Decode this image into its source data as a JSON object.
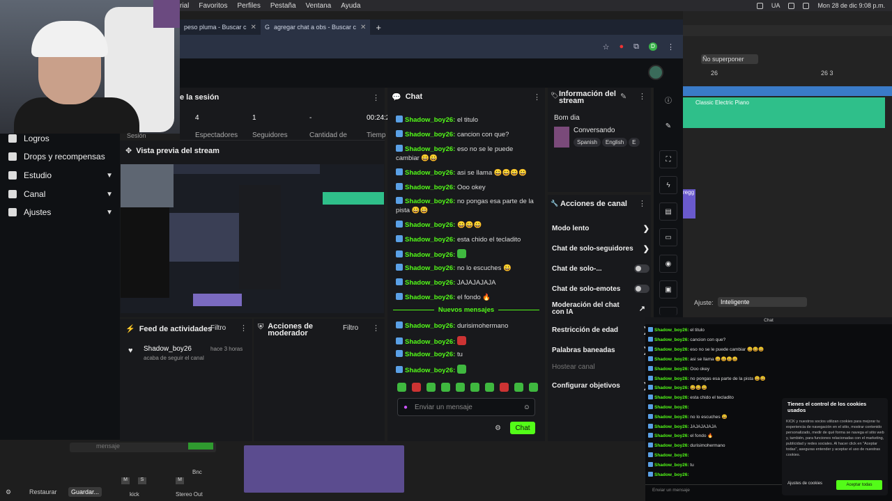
{
  "menubar": {
    "items": [
      "rial",
      "Favoritos",
      "Perfiles",
      "Pestaña",
      "Ventana",
      "Ayuda"
    ],
    "lang": "UA",
    "date": "Mon 28 de dic 9:08 p.m."
  },
  "browser": {
    "tabs": [
      "peso pluma - Buscar c",
      "agregar chat a obs - Buscar c"
    ],
    "profile_letter": "D"
  },
  "sidebar": {
    "items": [
      {
        "label": "Logros",
        "chev": false
      },
      {
        "label": "Drops y recompensas",
        "chev": false
      },
      {
        "label": "Estudio",
        "chev": true
      },
      {
        "label": "Canal",
        "chev": true
      },
      {
        "label": "Ajustes",
        "chev": true
      }
    ],
    "partial": "Sesión"
  },
  "session": {
    "title": "e la sesión",
    "stats": [
      {
        "v": "4",
        "l": "Espectadores"
      },
      {
        "v": "1",
        "l": "Seguidores"
      },
      {
        "v": "-",
        "l": "Cantidad de"
      },
      {
        "v": "00:24:2",
        "l": "Tiemp"
      }
    ]
  },
  "preview": {
    "title": "Vista previa del stream"
  },
  "feed": {
    "title": "Feed de actividades",
    "filter": "Filtro",
    "user": "Shadow_boy26",
    "time": "hace 3 horas",
    "desc": "acaba de seguir el canal"
  },
  "modactions": {
    "title": "Acciones de moderador",
    "filter": "Filtro"
  },
  "chat": {
    "title": "Chat",
    "messages": [
      {
        "u": "Shadow_boy26:",
        "t": "el titulo"
      },
      {
        "u": "Shadow_boy26:",
        "t": "cancion con que?"
      },
      {
        "u": "Shadow_boy26:",
        "t": "eso no se le puede cambiar 😀😀"
      },
      {
        "u": "Shadow_boy26:",
        "t": "asi se llama 😀😀😀😀"
      },
      {
        "u": "Shadow_boy26:",
        "t": "Ooo okey"
      },
      {
        "u": "Shadow_boy26:",
        "t": "no pongas esa parte de la pista 😀😀"
      },
      {
        "u": "Shadow_boy26:",
        "t": "😀😀😀"
      },
      {
        "u": "Shadow_boy26:",
        "t": "esta chido el tecladito"
      },
      {
        "u": "Shadow_boy26:",
        "t": ""
      },
      {
        "u": "Shadow_boy26:",
        "t": "no lo escuches 😀"
      },
      {
        "u": "Shadow_boy26:",
        "t": "JAJAJAJAJA"
      },
      {
        "u": "Shadow_boy26:",
        "t": "el fondo 🔥"
      }
    ],
    "new_label": "Nuevos mensajes",
    "new_messages": [
      {
        "u": "Shadow_boy26:",
        "t": "durisimohermano"
      },
      {
        "u": "Shadow_boy26:",
        "t": ""
      },
      {
        "u": "Shadow_boy26:",
        "t": "tu"
      },
      {
        "u": "Shadow_boy26:",
        "t": ""
      }
    ],
    "placeholder": "Enviar un mensaje",
    "send": "Chat"
  },
  "info": {
    "title": "Información del stream",
    "greeting": "Bom dia",
    "category": "Conversando",
    "tags": [
      "Spanish",
      "English",
      "E"
    ]
  },
  "actions": {
    "title": "Acciones de canal",
    "items": [
      {
        "label": "Modo lento",
        "kind": "chev"
      },
      {
        "label": "Chat de solo-seguidores",
        "kind": "chev"
      },
      {
        "label": "Chat de solo-...",
        "kind": "toggle"
      },
      {
        "label": "Chat de solo-emotes",
        "kind": "toggle"
      },
      {
        "label": "Moderación del chat con IA",
        "kind": "ext"
      },
      {
        "label": "Restricción de edad",
        "kind": "chev"
      },
      {
        "label": "Palabras baneadas",
        "kind": "chev"
      },
      {
        "label": "Hostear canal",
        "kind": "none"
      },
      {
        "label": "Configurar objetivos",
        "kind": "chev"
      }
    ]
  },
  "daw": {
    "overlap": "Ño superponer",
    "bar1": "26",
    "bar2": "26 3",
    "track": "Classic Electric Piano",
    "clip": "regg",
    "ajuste_label": "Ajuste:",
    "ajuste_val": "Inteligente"
  },
  "bottom": {
    "restaurar": "Restaurar",
    "guardar": "Guardar...",
    "kick": "kick",
    "stereo": "Stereo Out",
    "mensaje": "mensaje",
    "bnc": "Bnc"
  },
  "obs": {
    "title": "Chat",
    "messages": [
      {
        "u": "Shadow_boy26:",
        "t": "el titulo"
      },
      {
        "u": "Shadow_boy26:",
        "t": "cancion con que?"
      },
      {
        "u": "Shadow_boy26:",
        "t": "eso no se le puede cambiar 😀😀😀"
      },
      {
        "u": "Shadow_boy26:",
        "t": "asi se llama 😀😀😀😀"
      },
      {
        "u": "Shadow_boy26:",
        "t": "Ooo okey"
      },
      {
        "u": "Shadow_boy26:",
        "t": "no pongas esa parte de la pista 😀😀"
      },
      {
        "u": "Shadow_boy26:",
        "t": "😀😀😀"
      },
      {
        "u": "Shadow_boy26:",
        "t": "esta chido el tecladito"
      },
      {
        "u": "Shadow_boy26:",
        "t": ""
      },
      {
        "u": "Shadow_boy26:",
        "t": "no lo escuches 😀"
      },
      {
        "u": "Shadow_boy26:",
        "t": "JAJAJAJAJA"
      },
      {
        "u": "Shadow_boy26:",
        "t": "el fondo 🔥"
      },
      {
        "u": "Shadow_boy26:",
        "t": "durisimohermano"
      },
      {
        "u": "Shadow_boy26:",
        "t": ""
      },
      {
        "u": "Shadow_boy26:",
        "t": "tu"
      },
      {
        "u": "Shadow_boy26:",
        "t": ""
      }
    ],
    "placeholder": "Enviar un mensaje"
  },
  "cookie": {
    "title": "Tienes el control de los cookies usados",
    "body": "KICK y nuestros socios utilizan cookies para mejorar tu experiencia de navegación en el sitio, mostrar contenido personalizado, medir de qué forma se navega el sitio web y, también, para funciones relacionadas con el marketing, publicidad y redes sociales. Al hacer click en \"Aceptar todas\", aseguras entender y aceptar el uso de nuestras cookies.",
    "settings": "Ajustes de cookies",
    "accept": "Aceptar todas"
  }
}
